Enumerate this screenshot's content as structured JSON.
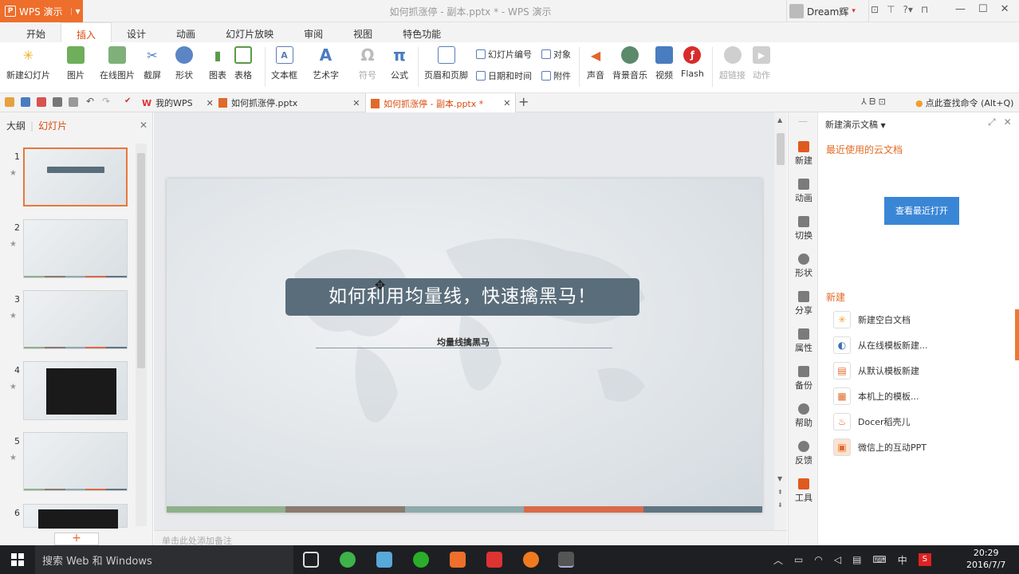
{
  "app": {
    "name": "WPS 演示",
    "window_title": "如何抓涨停 - 副本.pptx * - WPS 演示",
    "user": "Dream辉"
  },
  "menu_tabs": [
    "开始",
    "插入",
    "设计",
    "动画",
    "幻灯片放映",
    "审阅",
    "视图",
    "特色功能"
  ],
  "active_tab": "插入",
  "ribbon": {
    "new_slide": "新建幻灯片",
    "picture": "图片",
    "online_picture": "在线图片",
    "screenshot": "截屏",
    "shape": "形状",
    "chart": "图表",
    "table": "表格",
    "textbox": "文本框",
    "wordart": "艺术字",
    "symbol": "符号",
    "formula": "公式",
    "header_footer": "页眉和页脚",
    "slide_number": "幻灯片编号",
    "object": "对象",
    "date_time": "日期和时间",
    "attachment": "附件",
    "sound": "声音",
    "bg_music": "背景音乐",
    "video": "视频",
    "flash": "Flash",
    "hyperlink": "超链接",
    "action": "动作"
  },
  "doc_tabs": [
    {
      "label": "我的WPS"
    },
    {
      "label": "如何抓涨停.pptx"
    },
    {
      "label": "如何抓涨停 - 副本.pptx *"
    }
  ],
  "find_command": "点此查找命令 (Alt+Q)",
  "left_panel": {
    "outline": "大纲",
    "slides": "幻灯片"
  },
  "slide_numbers": [
    "1",
    "2",
    "3",
    "4",
    "5",
    "6"
  ],
  "slide": {
    "title": "如何利用均量线，快速擒黑马！",
    "subtitle": "均量线擒黑马",
    "bar_colors": [
      "#8fb08a",
      "#8a7a70",
      "#8fa9ac",
      "#d96a4a",
      "#5f7582"
    ]
  },
  "notes_placeholder": "单击此处添加备注",
  "side_tools": [
    "新建",
    "动画",
    "切换",
    "形状",
    "分享",
    "属性",
    "备份",
    "帮助",
    "反馈",
    "工具"
  ],
  "task_pane": {
    "header": "新建演示文稿",
    "recent_label": "最近使用的云文档",
    "view_recent": "查看最近打开",
    "new_label": "新建",
    "items": [
      "新建空白文档",
      "从在线模板新建...",
      "从默认模板新建",
      "本机上的模板...",
      "Docer稻壳儿",
      "微信上的互动PPT"
    ]
  },
  "taskbar": {
    "search": "搜索 Web 和 Windows",
    "ime": "中",
    "time": "20:29",
    "date": "2016/7/7"
  },
  "colors": {
    "accent": "#ee6e2b",
    "title_box": "#5a6d7b",
    "link_orange": "#e26b25",
    "button_blue": "#3a86d6"
  }
}
